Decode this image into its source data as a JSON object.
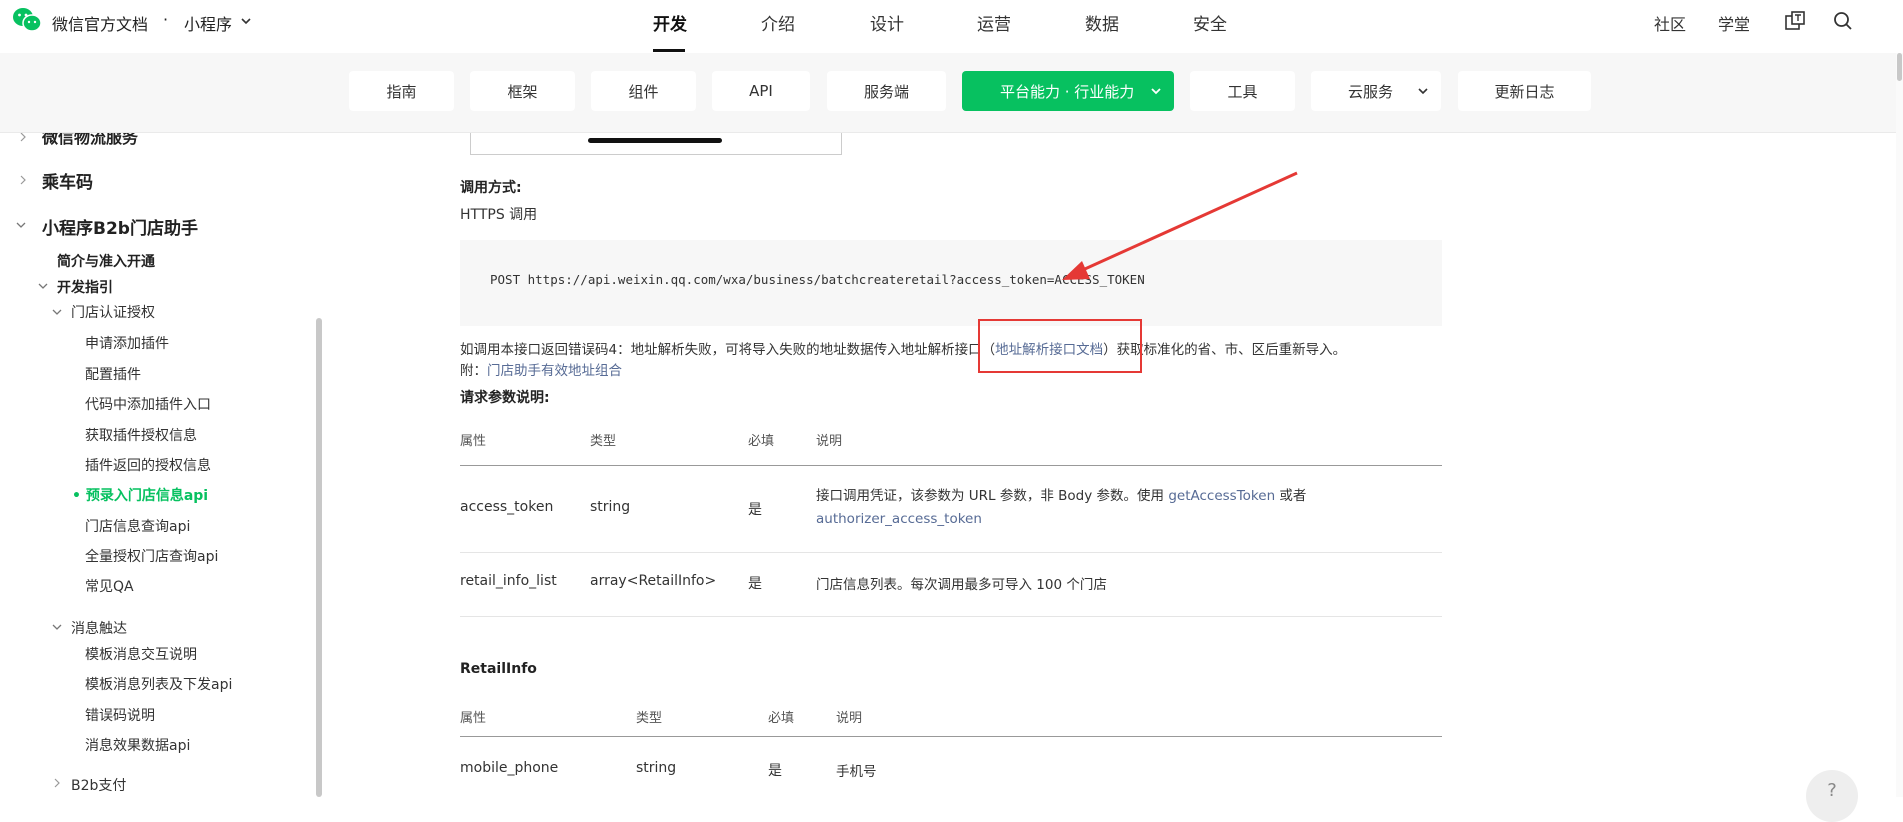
{
  "header": {
    "brand": "微信官方文档",
    "separator": "·",
    "product": "小程序",
    "nav": [
      "开发",
      "介绍",
      "设计",
      "运营",
      "数据",
      "安全"
    ],
    "active_nav": "开发",
    "right": [
      "社区",
      "学堂"
    ]
  },
  "categories": [
    "指南",
    "框架",
    "组件",
    "API",
    "服务端",
    "平台能力 · 行业能力",
    "工具",
    "云服务",
    "更新日志"
  ],
  "sidebar": {
    "items": [
      {
        "label": "微信物流服务"
      },
      {
        "label": "乘车码"
      },
      {
        "label": "小程序B2b门店助手"
      },
      {
        "label": "简介与准入开通"
      },
      {
        "label": "开发指引"
      },
      {
        "label": "门店认证授权"
      },
      {
        "label": "申请添加插件"
      },
      {
        "label": "配置插件"
      },
      {
        "label": "代码中添加插件入口"
      },
      {
        "label": "获取插件授权信息"
      },
      {
        "label": "插件返回的授权信息"
      },
      {
        "label": "预录入门店信息api"
      },
      {
        "label": "门店信息查询api"
      },
      {
        "label": "全量授权门店查询api"
      },
      {
        "label": "常见QA"
      },
      {
        "label": "消息触达"
      },
      {
        "label": "模板消息交互说明"
      },
      {
        "label": "模板消息列表及下发api"
      },
      {
        "label": "错误码说明"
      },
      {
        "label": "消息效果数据api"
      },
      {
        "label": "B2b支付"
      }
    ]
  },
  "content": {
    "call_heading": "调用方式:",
    "call_method": "HTTPS 调用",
    "code": "POST https://api.weixin.qq.com/wxa/business/batchcreateretail?access_token=ACCESS_TOKEN",
    "note_prefix": "如调用本接口返回错误码4：地址解析失败，可将导入失败的地址数据传入地址解析接口（",
    "note_link": "地址解析接口文档",
    "note_suffix": "）获取标准化的省、市、区后重新导入。",
    "attach_prefix": "附：",
    "attach_link": "门店助手有效地址组合",
    "params_heading": "请求参数说明:",
    "table1": {
      "headers": [
        "属性",
        "类型",
        "必填",
        "说明"
      ],
      "rows": [
        {
          "name": "access_token",
          "type": "string",
          "required": "是",
          "desc_prefix": "接口调用凭证，该参数为 URL 参数，非 Body 参数。使用 ",
          "desc_link1": "getAccessToken",
          "desc_mid": " 或者",
          "desc_link2": "authorizer_access_token"
        },
        {
          "name": "retail_info_list",
          "type": "array<RetailInfo>",
          "required": "是",
          "desc": "门店信息列表。每次调用最多可导入 100 个门店"
        }
      ]
    },
    "retail_heading": "RetailInfo",
    "table2": {
      "headers": [
        "属性",
        "类型",
        "必填",
        "说明"
      ],
      "rows": [
        {
          "name": "mobile_phone",
          "type": "string",
          "required": "是",
          "desc": "手机号"
        }
      ]
    }
  },
  "help": "?",
  "colors": {
    "accent": "#07c160",
    "link": "#576b95",
    "annotation": "#e53935"
  }
}
